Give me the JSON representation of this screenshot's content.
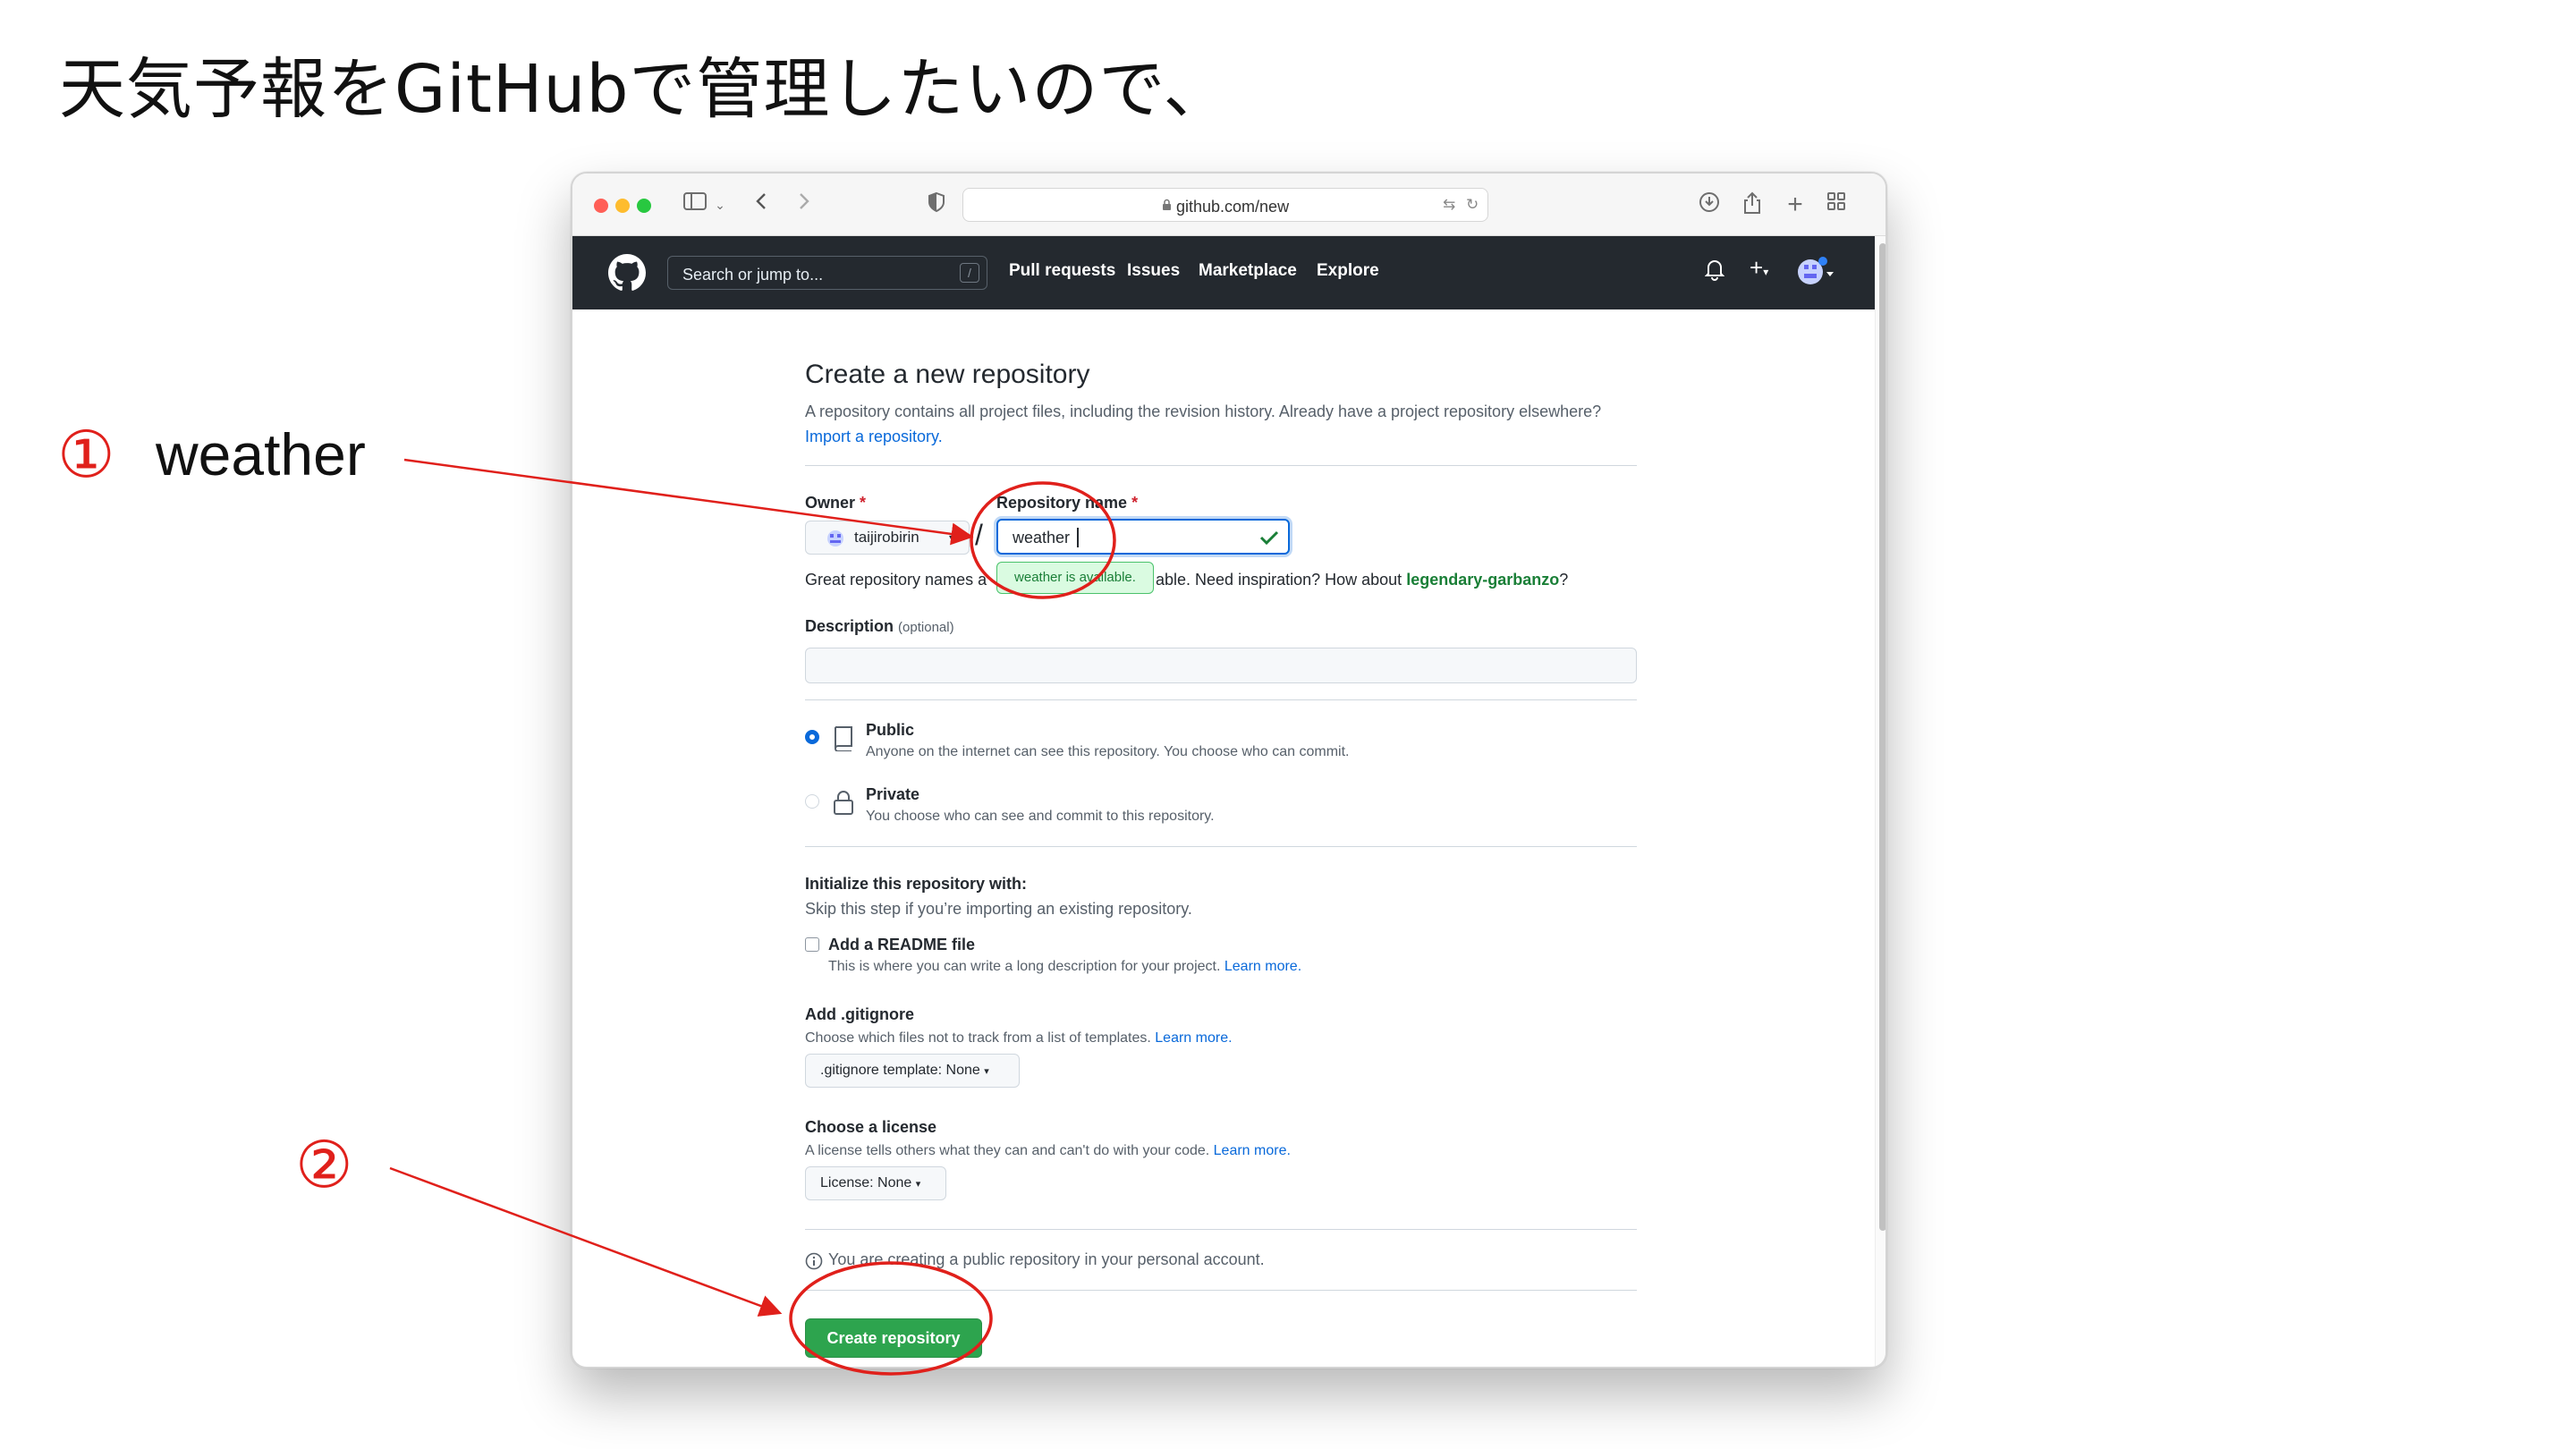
{
  "slide": {
    "title": "天気予報をGitHubで管理したいので、",
    "step1_num": "①",
    "step1_label": "weather",
    "step2_num": "②"
  },
  "browser": {
    "url": "github.com/new"
  },
  "gh_header": {
    "search_placeholder": "Search or jump to...",
    "search_shortcut": "/",
    "nav": [
      "Pull requests",
      "Issues",
      "Marketplace",
      "Explore"
    ]
  },
  "form": {
    "title": "Create a new repository",
    "subtitle": "A repository contains all project files, including the revision history. Already have a project repository elsewhere?",
    "import_link": "Import a repository.",
    "owner_label": "Owner",
    "repo_label": "Repository name",
    "required_mark": "*",
    "owner_value": "taijirobirin",
    "slash": "/",
    "repo_value": "weather",
    "tooltip": "weather is available.",
    "hint_prefix": "Great repository names a",
    "hint_suffix": "able. Need inspiration? How about",
    "suggestion": "legendary-garbanzo",
    "hint_end": "?",
    "description_label": "Description",
    "optional": "(optional)",
    "public_title": "Public",
    "public_desc": "Anyone on the internet can see this repository. You choose who can commit.",
    "private_title": "Private",
    "private_desc": "You choose who can see and commit to this repository.",
    "init_title": "Initialize this repository with:",
    "init_desc": "Skip this step if you’re importing an existing repository.",
    "readme_title": "Add a README file",
    "readme_desc": "This is where you can write a long description for your project.",
    "learn_more": "Learn more.",
    "gitignore_title": "Add .gitignore",
    "gitignore_desc": "Choose which files not to track from a list of templates.",
    "gitignore_btn": ".gitignore template: None",
    "license_title": "Choose a license",
    "license_desc": "A license tells others what they can and can't do with your code.",
    "license_btn": "License: None",
    "info_text": "You are creating a public repository in your personal account.",
    "create_btn": "Create repository"
  },
  "colors": {
    "annotation": "#e0201b",
    "gh_header": "#24292f",
    "primary_button": "#2da44e",
    "link": "#0969da"
  }
}
